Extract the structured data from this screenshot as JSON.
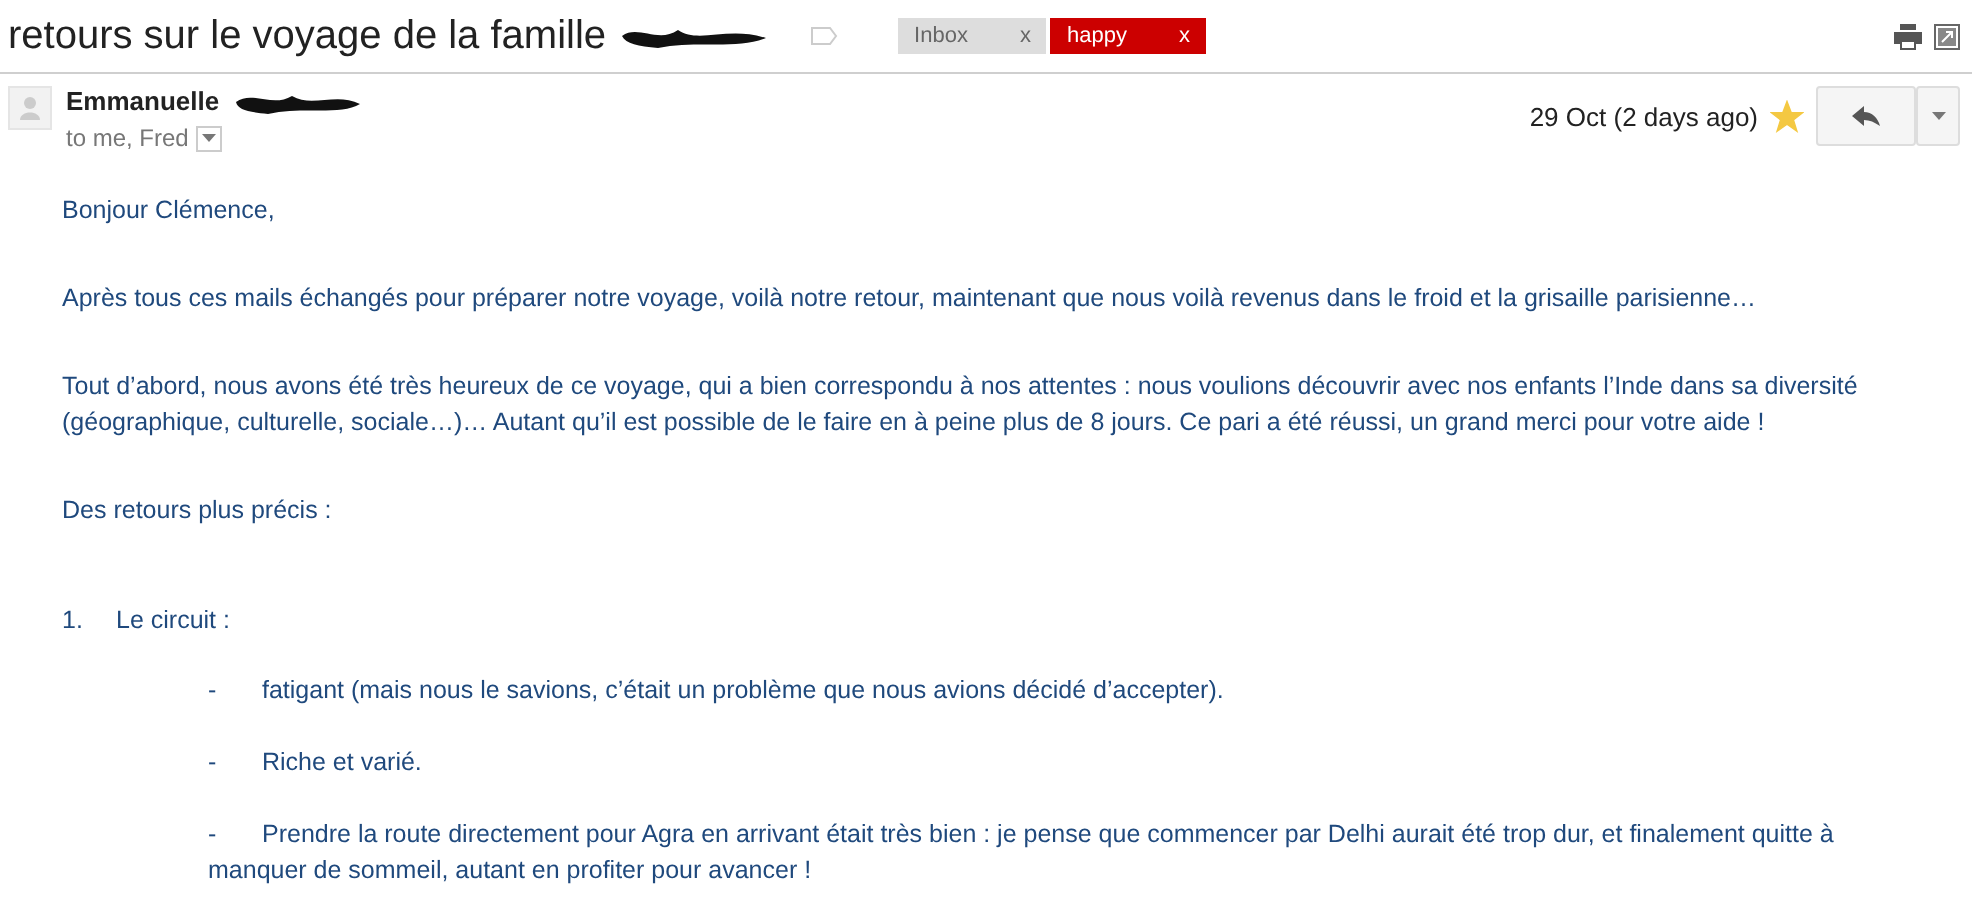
{
  "subject": "retours sur le voyage de la famille",
  "labels": [
    {
      "name": "Inbox",
      "remove": "x",
      "color": "#dddddd"
    },
    {
      "name": "happy",
      "remove": "x",
      "color": "#cc0000"
    }
  ],
  "message": {
    "sender": "Emmanuelle",
    "recipients": "to me, Fred",
    "date": "29 Oct (2 days ago)",
    "starred": true
  },
  "body": [
    {
      "kind": "text",
      "text": "Bonjour Clémence,"
    },
    {
      "kind": "text",
      "text": "Après tous ces mails échangés pour préparer notre voyage, voilà notre retour, maintenant que nous voilà revenus dans le froid et la grisaille parisienne…"
    },
    {
      "kind": "text",
      "text": "Tout d’abord, nous avons été très heureux de ce voyage, qui a bien correspondu à nos attentes : nous voulions découvrir avec nos enfants l’Inde dans sa diversité (géographique, culturelle, sociale…)… Autant qu’il est possible de le faire en à peine plus de 8 jours. Ce pari a été réussi, un grand merci pour votre aide !"
    },
    {
      "kind": "text",
      "text": "Des retours plus précis :"
    },
    {
      "kind": "numbered",
      "marker": "1.",
      "text": "Le circuit :"
    },
    {
      "kind": "bullet",
      "marker": "-",
      "text": "fatigant (mais nous le savions, c’était un problème que nous avions décidé d’accepter)."
    },
    {
      "kind": "bullet",
      "marker": "-",
      "text": "Riche et varié."
    },
    {
      "kind": "bullet",
      "marker": "-",
      "text": "Prendre la route directement pour Agra en arrivant était très bien : je pense que commencer par Delhi aurait été trop dur, et finalement quitte à manquer de sommeil, autant en profiter pour avancer !"
    }
  ]
}
